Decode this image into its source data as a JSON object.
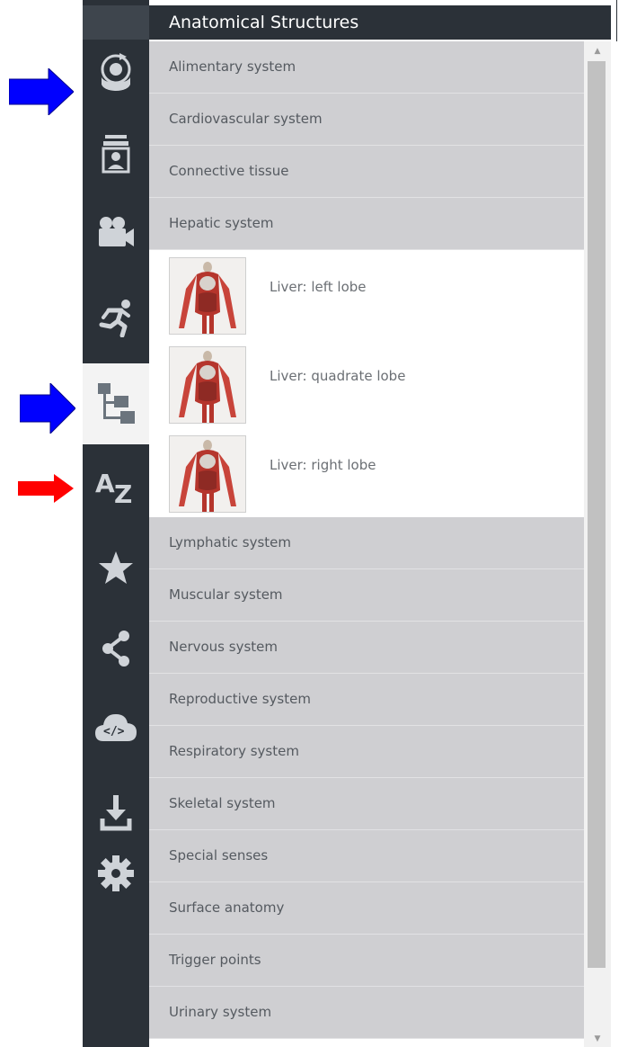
{
  "header": {
    "title": "Anatomical Structures"
  },
  "sidebar": {
    "items": [
      {
        "icon": "rotate-view-icon",
        "active": false
      },
      {
        "icon": "person-id-icon",
        "active": false
      },
      {
        "icon": "video-camera-icon",
        "active": false
      },
      {
        "icon": "running-figure-icon",
        "active": false
      },
      {
        "icon": "hierarchy-tree-icon",
        "active": true
      },
      {
        "icon": "a-z-icon",
        "label": "A Z",
        "active": false
      },
      {
        "icon": "star-icon",
        "active": false
      },
      {
        "icon": "share-icon",
        "active": false
      },
      {
        "icon": "cloud-code-icon",
        "active": false
      },
      {
        "icon": "download-icon",
        "active": false
      },
      {
        "icon": "gear-icon",
        "active": false
      }
    ]
  },
  "list": {
    "categories_before": [
      "Alimentary system",
      "Cardiovascular system",
      "Connective tissue",
      "Hepatic system"
    ],
    "sub_items": [
      {
        "label": "Liver: left lobe",
        "thumbnail": "anatomy-body-thumbnail"
      },
      {
        "label": "Liver: quadrate lobe",
        "thumbnail": "anatomy-body-thumbnail"
      },
      {
        "label": "Liver: right lobe",
        "thumbnail": "anatomy-body-thumbnail"
      }
    ],
    "categories_after": [
      "Lymphatic system",
      "Muscular system",
      "Nervous system",
      "Reproductive system",
      "Respiratory system",
      "Skeletal system",
      "Special senses",
      "Surface anatomy",
      "Trigger points",
      "Urinary system"
    ]
  },
  "annotations": {
    "arrow_colors": {
      "blue": "#0000ff",
      "red": "#ff0000"
    }
  },
  "colors": {
    "sidebar": "#2b3138",
    "category_bg": "#cfcfd2",
    "active_sidebar": "#f3f3f3"
  }
}
